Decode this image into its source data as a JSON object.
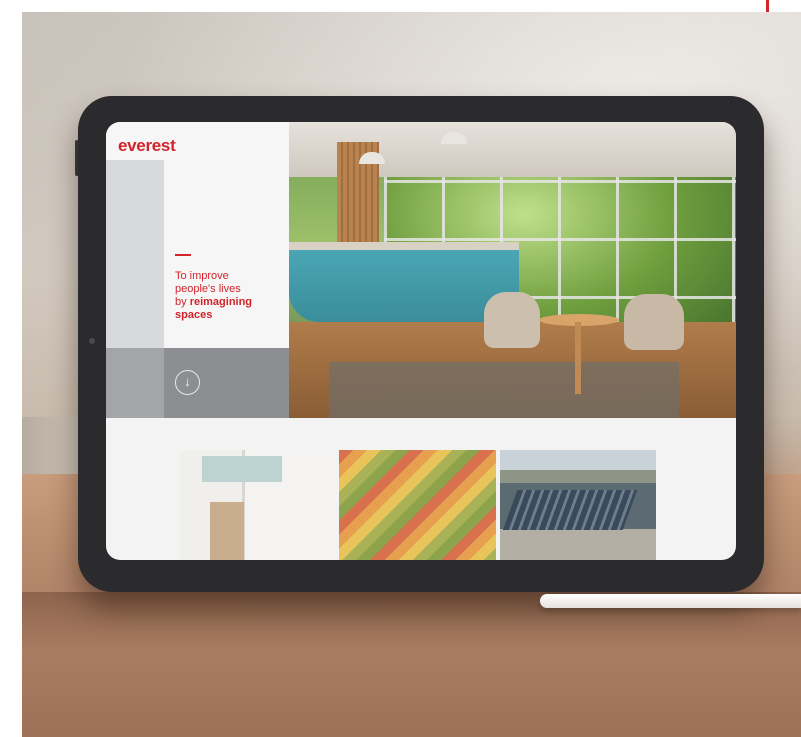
{
  "brand": {
    "logo": "everest",
    "accent_color": "#d3232b"
  },
  "hero": {
    "tagline_line1": "To improve",
    "tagline_line2": "people's lives",
    "tagline_line3_prefix": "by ",
    "tagline_bold": "reimagining",
    "tagline_line4": "spaces",
    "scroll_icon": "arrow-down-icon"
  },
  "colors": {
    "panel_gray": "#8d8e91",
    "screen_bg": "#f3f3f3"
  }
}
